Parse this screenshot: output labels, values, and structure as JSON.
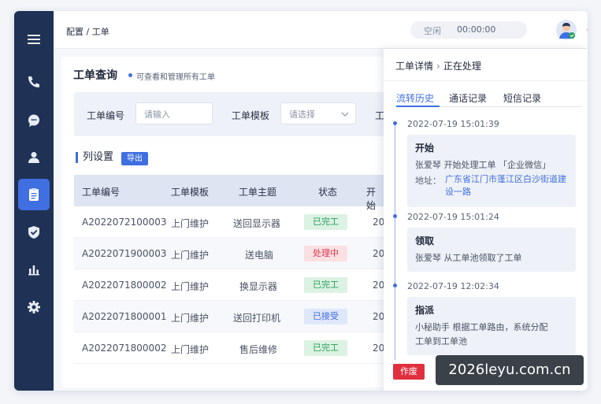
{
  "topbar": {
    "breadcrumb": "配置 / 工单",
    "status": "空闲",
    "timer": "00:00:00"
  },
  "sidebar": {
    "items": [
      {
        "icon": "menu-icon"
      },
      {
        "icon": "phone-icon"
      },
      {
        "icon": "chat-icon"
      },
      {
        "icon": "user-icon"
      },
      {
        "icon": "clipboard-icon",
        "active": true
      },
      {
        "icon": "shield-icon"
      },
      {
        "icon": "bar-chart-icon"
      },
      {
        "icon": "gear-icon"
      }
    ]
  },
  "main": {
    "title": "工单查询",
    "subtitle": "可查看和管理所有工单",
    "filters": {
      "ticket_no_label": "工单编号",
      "ticket_no_placeholder": "请输入",
      "template_label": "工单模板",
      "template_placeholder": "请选择",
      "third_label": "工"
    },
    "column_settings": "列设置",
    "export": "导出",
    "table": {
      "headers": [
        "工单编号",
        "工单模板",
        "工单主题",
        "状态",
        "开始"
      ],
      "rows": [
        {
          "id": "A2022072100003",
          "template": "上门维护",
          "subject": "送回显示器",
          "status": "已完工",
          "start": "20"
        },
        {
          "id": "A2022071900003",
          "template": "上门维护",
          "subject": "送电脑",
          "status": "处理中",
          "start": "20"
        },
        {
          "id": "A2022071800002",
          "template": "上门维护",
          "subject": "换显示器",
          "status": "已完工",
          "start": "20"
        },
        {
          "id": "A2022071800001",
          "template": "上门维护",
          "subject": "送回打印机",
          "status": "已接受",
          "start": "20"
        },
        {
          "id": "A2022071800002",
          "template": "上门维护",
          "subject": "售后维修",
          "status": "已完工",
          "start": "20"
        }
      ]
    }
  },
  "detail": {
    "title": "工单详情",
    "state": "正在处理",
    "tabs": [
      "流转历史",
      "通话记录",
      "短信记录"
    ],
    "timeline": [
      {
        "time": "2022-07-19  15:01:39",
        "title": "开始",
        "line1": "张爱琴  开始处理工单  「企业微信」",
        "addr_label": "地址：",
        "addr_value": "广东省江门市蓬江区白沙街道建设一路"
      },
      {
        "time": "2022-07-19  15:01:24",
        "title": "领取",
        "line1": "张爱琴  从工单池领取了工单"
      },
      {
        "time": "2022-07-19  12:02:34",
        "title": "指派",
        "line1": "小秘助手  根据工单路由，系统分配",
        "line2": "工单到工单池"
      }
    ],
    "void_button": "作废"
  },
  "watermark": "2026leyu.com.cn",
  "colors": {
    "sidebar": "#1f3154",
    "accent": "#3f6fe0",
    "done": "#2aa05a",
    "processing": "#d9394b",
    "danger": "#e0303f"
  }
}
